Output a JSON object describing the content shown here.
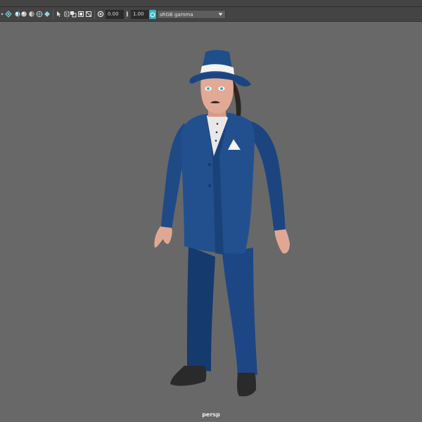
{
  "toolbar": {
    "icons": [
      "select-camera-icon",
      "lock-camera-icon",
      "bookmark-icon",
      "wireframe-icon",
      "smooth-shade-icon",
      "textured-icon",
      "lights-icon",
      "cursor-icon",
      "isolate-icon",
      "xray-icon",
      "backface-icon",
      "grid-icon",
      "exposure-icon",
      "gamma-icon"
    ],
    "exposure_value": "0.00",
    "gamma_value": "1.00",
    "color_space": "sRGB gamma"
  },
  "viewport": {
    "camera_label": "persp",
    "background_color": "#686868",
    "model": {
      "suit_color": "#1f4a86",
      "shirt_color": "#e8e8ea",
      "skin_color": "#e0a894",
      "shoe_color": "#2a2a2a",
      "hat_band_color": "#f4f4f4"
    }
  }
}
